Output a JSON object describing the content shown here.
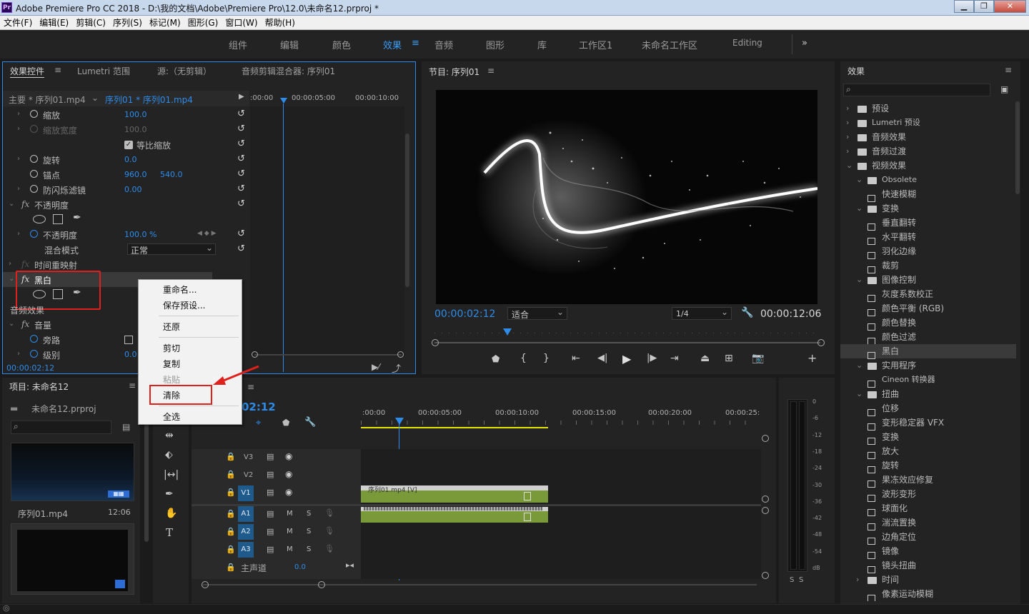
{
  "window": {
    "title": "Adobe Premiere Pro CC 2018 - D:\\我的文档\\Adobe\\Premiere Pro\\12.0\\未命名12.prproj *",
    "app_badge": "Pr"
  },
  "menu": [
    "文件(F)",
    "编辑(E)",
    "剪辑(C)",
    "序列(S)",
    "标记(M)",
    "图形(G)",
    "窗口(W)",
    "帮助(H)"
  ],
  "workspaces": [
    "组件",
    "编辑",
    "颜色",
    "效果",
    "音频",
    "图形",
    "库",
    "工作区1",
    "未命名工作区",
    "Editing"
  ],
  "workspace_active": "效果",
  "effect_controls": {
    "tabs": [
      "效果控件",
      "Lumetri 范围",
      "源:（无剪辑）",
      "音频剪辑混合器: 序列01"
    ],
    "master": "主要 * 序列01.mp4",
    "clip": "序列01 * 序列01.mp4",
    "time_labels": [
      ":00:00",
      "00:00:05:00",
      "00:00:10:00"
    ],
    "rows": {
      "scale": {
        "label": "缩放",
        "value": "100.0"
      },
      "scale_width": {
        "label": "缩放宽度",
        "value": "100.0"
      },
      "uniform": {
        "label": "等比缩放"
      },
      "rotation": {
        "label": "旋转",
        "value": "0.0"
      },
      "anchor": {
        "label": "锚点",
        "value_x": "960.0",
        "value_y": "540.0"
      },
      "flicker": {
        "label": "防闪烁滤镜",
        "value": "0.00"
      },
      "opacity_group": {
        "label": "不透明度"
      },
      "opacity": {
        "label": "不透明度",
        "value": "100.0 %"
      },
      "blend": {
        "label": "混合模式",
        "value": "正常"
      },
      "time_remap": {
        "label": "时间重映射"
      },
      "bw": {
        "label": "黑白"
      },
      "audio_fx": {
        "label": "音频效果"
      },
      "volume": {
        "label": "音量"
      },
      "bypass": {
        "label": "旁路"
      },
      "level": {
        "label": "级别",
        "value": "0.0"
      }
    },
    "timecode": "00:00:02:12"
  },
  "context_menu": {
    "items": [
      "重命名...",
      "保存预设...",
      "还原",
      "剪切",
      "复制",
      "粘贴",
      "清除",
      "全选"
    ],
    "highlighted": "清除"
  },
  "program": {
    "title": "节目: 序列01",
    "timecode": "00:00:02:12",
    "fit": "适合",
    "resolution": "1/4",
    "duration": "00:00:12:06"
  },
  "effects": {
    "title": "效果",
    "items": [
      {
        "label": "预设",
        "type": "folder",
        "level": 0
      },
      {
        "label": "Lumetri 预设",
        "type": "folder",
        "level": 0
      },
      {
        "label": "音频效果",
        "type": "folder",
        "level": 0
      },
      {
        "label": "音频过渡",
        "type": "folder",
        "level": 0
      },
      {
        "label": "视频效果",
        "type": "folder",
        "level": 0,
        "open": true
      },
      {
        "label": "Obsolete",
        "type": "folder",
        "level": 1,
        "open": true
      },
      {
        "label": "快速模糊",
        "type": "fx",
        "level": 2
      },
      {
        "label": "变换",
        "type": "folder",
        "level": 1,
        "open": true
      },
      {
        "label": "垂直翻转",
        "type": "fx",
        "level": 2
      },
      {
        "label": "水平翻转",
        "type": "fx",
        "level": 2
      },
      {
        "label": "羽化边缘",
        "type": "fx",
        "level": 2
      },
      {
        "label": "裁剪",
        "type": "fx",
        "level": 2
      },
      {
        "label": "图像控制",
        "type": "folder",
        "level": 1,
        "open": true
      },
      {
        "label": "灰度系数校正",
        "type": "fx",
        "level": 2
      },
      {
        "label": "颜色平衡 (RGB)",
        "type": "fx",
        "level": 2
      },
      {
        "label": "颜色替换",
        "type": "fx",
        "level": 2
      },
      {
        "label": "颜色过滤",
        "type": "fx",
        "level": 2
      },
      {
        "label": "黑白",
        "type": "fx",
        "level": 2,
        "selected": true
      },
      {
        "label": "实用程序",
        "type": "folder",
        "level": 1,
        "open": true
      },
      {
        "label": "Cineon 转换器",
        "type": "fx",
        "level": 2
      },
      {
        "label": "扭曲",
        "type": "folder",
        "level": 1,
        "open": true
      },
      {
        "label": "位移",
        "type": "fx",
        "level": 2
      },
      {
        "label": "变形稳定器 VFX",
        "type": "fx",
        "level": 2
      },
      {
        "label": "变换",
        "type": "fx",
        "level": 2
      },
      {
        "label": "放大",
        "type": "fx",
        "level": 2
      },
      {
        "label": "旋转",
        "type": "fx",
        "level": 2
      },
      {
        "label": "果冻效应修复",
        "type": "fx",
        "level": 2
      },
      {
        "label": "波形变形",
        "type": "fx",
        "level": 2
      },
      {
        "label": "球面化",
        "type": "fx",
        "level": 2
      },
      {
        "label": "湍流置换",
        "type": "fx",
        "level": 2
      },
      {
        "label": "边角定位",
        "type": "fx",
        "level": 2
      },
      {
        "label": "镜像",
        "type": "fx",
        "level": 2
      },
      {
        "label": "镜头扭曲",
        "type": "fx",
        "level": 2
      },
      {
        "label": "时间",
        "type": "folder",
        "level": 1
      },
      {
        "label": "像素运动模糊",
        "type": "fx",
        "level": 2
      }
    ]
  },
  "project": {
    "title": "项目: 未命名12",
    "file": "未命名12.prproj",
    "clip_name": "序列01.mp4",
    "clip_duration": "12:06"
  },
  "timeline": {
    "timecode": "02:12",
    "ruler": [
      ":00:00",
      "00:00:05:00",
      "00:00:10:00",
      "00:00:15:00",
      "00:00:20:00",
      "00:00:25:"
    ],
    "video_tracks": [
      "V3",
      "V2",
      "V1"
    ],
    "audio_tracks": [
      "A1",
      "A2",
      "A3"
    ],
    "master": "主声道",
    "master_value": "0.0",
    "clip_label": "序列01.mp4 [V]"
  },
  "meter": {
    "labels": [
      "0",
      "-6",
      "-12",
      "-18",
      "-24",
      "-30",
      "-36",
      "-42",
      "-48",
      "-54",
      "dB"
    ],
    "channels": [
      "S",
      "S"
    ]
  },
  "colors": {
    "accent": "#2d8ceb",
    "panel": "#232323",
    "highlight_box": "#e0201c",
    "clip_green": "#7a9a3a"
  }
}
